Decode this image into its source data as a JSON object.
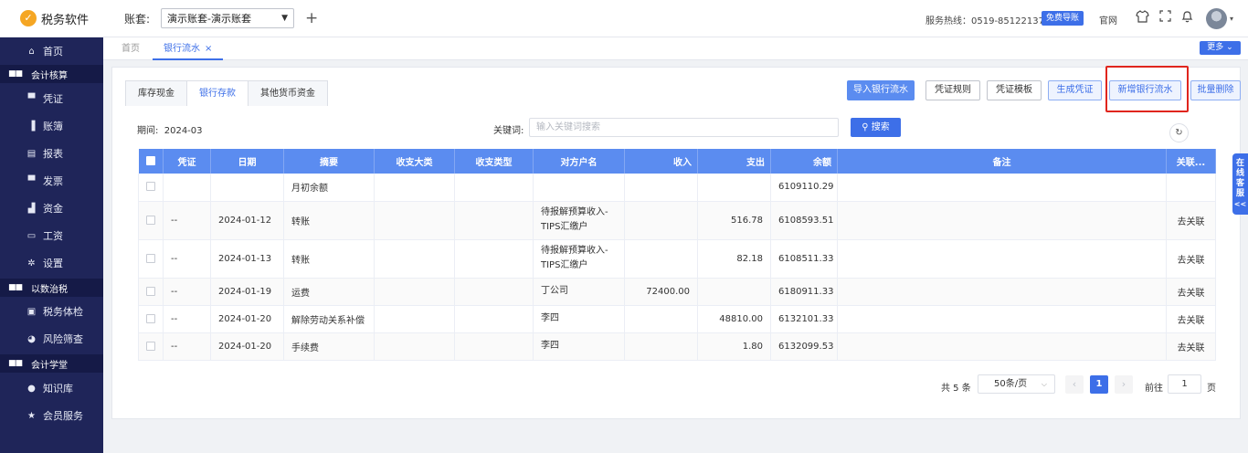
{
  "app": {
    "name": "税务软件",
    "logo_glyph": "✓"
  },
  "account": {
    "label": "账套:",
    "selected": "演示账套-演示账套"
  },
  "header": {
    "hotline": "服务热线：0519-85122137",
    "guide_button": "免费导账",
    "official_site": "官网"
  },
  "sidebar": {
    "items_top": [
      {
        "label": "首页",
        "icon": "home-icon",
        "glyph": "⌂"
      }
    ],
    "group1": {
      "label": "会计核算",
      "icon": "grid-icon"
    },
    "items_g1": [
      {
        "label": "凭证",
        "icon": "voucher-icon",
        "glyph": "▀"
      },
      {
        "label": "账簿",
        "icon": "ledger-icon",
        "glyph": "▐"
      },
      {
        "label": "报表",
        "icon": "report-icon",
        "glyph": "▤"
      },
      {
        "label": "发票",
        "icon": "invoice-icon",
        "glyph": "▀"
      },
      {
        "label": "资金",
        "icon": "fund-icon",
        "glyph": "▟"
      },
      {
        "label": "工资",
        "icon": "salary-icon",
        "glyph": "▭"
      },
      {
        "label": "设置",
        "icon": "gear-icon",
        "glyph": "✲"
      }
    ],
    "group2": {
      "label": "以数治税",
      "icon": "grid-icon"
    },
    "items_g2": [
      {
        "label": "税务体检",
        "icon": "checkup-icon",
        "glyph": "▣"
      },
      {
        "label": "风险筛查",
        "icon": "risk-icon",
        "glyph": "◕"
      }
    ],
    "group3": {
      "label": "会计学堂",
      "icon": "grid-icon"
    },
    "items_g3": [
      {
        "label": "知识库",
        "icon": "location-icon",
        "glyph": "●"
      },
      {
        "label": "会员服务",
        "icon": "star-icon",
        "glyph": "★"
      }
    ]
  },
  "tabbar": {
    "tabs": [
      {
        "label": "首页"
      },
      {
        "label": "银行流水"
      }
    ],
    "more_button": "更多 ⌄"
  },
  "subtabs": [
    "库存现金",
    "银行存款",
    "其他货币资金"
  ],
  "actions": {
    "import": "导入银行流水",
    "voucher_rules": "凭证规则",
    "voucher_template": "凭证模板",
    "generate_voucher": "生成凭证",
    "add_bank_flow": "新增银行流水",
    "batch_delete": "批量删除"
  },
  "filters": {
    "period_label": "期间:",
    "period_value": "2024-03",
    "keyword_label": "关键词:",
    "keyword_placeholder": "输入关键词搜索",
    "search_button": "搜索"
  },
  "table": {
    "columns": [
      "凭证",
      "日期",
      "摘要",
      "收支大类",
      "收支类型",
      "对方户名",
      "收入",
      "支出",
      "余额",
      "备注",
      "关联..."
    ],
    "rows": [
      {
        "voucher": "",
        "date": "",
        "summary": "月初余额",
        "category": "",
        "type": "",
        "counterparty": "",
        "income": "",
        "expense": "",
        "balance": "6109110.29",
        "note": "",
        "link": ""
      },
      {
        "voucher": "--",
        "date": "2024-01-12",
        "summary": "转账",
        "category": "",
        "type": "",
        "counterparty": "待报解预算收入-TIPS汇缴户",
        "income": "",
        "expense": "516.78",
        "balance": "6108593.51",
        "note": "",
        "link": "去关联"
      },
      {
        "voucher": "--",
        "date": "2024-01-13",
        "summary": "转账",
        "category": "",
        "type": "",
        "counterparty": "待报解预算收入-TIPS汇缴户",
        "income": "",
        "expense": "82.18",
        "balance": "6108511.33",
        "note": "",
        "link": "去关联"
      },
      {
        "voucher": "--",
        "date": "2024-01-19",
        "summary": "运费",
        "category": "",
        "type": "",
        "counterparty": "丁公司",
        "income": "72400.00",
        "expense": "",
        "balance": "6180911.33",
        "note": "",
        "link": "去关联"
      },
      {
        "voucher": "--",
        "date": "2024-01-20",
        "summary": "解除劳动关系补偿",
        "category": "",
        "type": "",
        "counterparty": "李四",
        "income": "",
        "expense": "48810.00",
        "balance": "6132101.33",
        "note": "",
        "link": "去关联"
      },
      {
        "voucher": "--",
        "date": "2024-01-20",
        "summary": "手续费",
        "category": "",
        "type": "",
        "counterparty": "李四",
        "income": "",
        "expense": "1.80",
        "balance": "6132099.53",
        "note": "",
        "link": "去关联"
      }
    ]
  },
  "pagination": {
    "total": "共 5 条",
    "page_size": "50条/页",
    "current_page": "1",
    "goto_label": "前往",
    "goto_value": "1",
    "page_unit": "页"
  },
  "service_tab": "在线客服",
  "colors": {
    "primary": "#3d6fe8",
    "sidebar": "#1f2559",
    "highlight": "#e0251d",
    "table_header": "#5b8cf0"
  }
}
